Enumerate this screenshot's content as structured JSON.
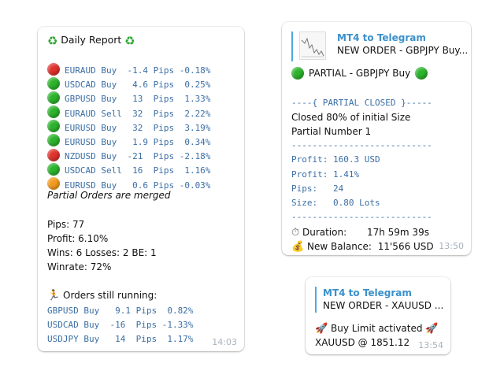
{
  "daily_report": {
    "title": "Daily Report",
    "trades": [
      {
        "status": "red",
        "text": "EURAUD Buy  -1.4 Pips -0.18%"
      },
      {
        "status": "green",
        "text": "USDCAD Buy   4.6 Pips  0.25%"
      },
      {
        "status": "green",
        "text": "GBPUSD Buy   13  Pips  1.33%"
      },
      {
        "status": "green",
        "text": "EURAUD Sell  32  Pips  2.22%"
      },
      {
        "status": "green",
        "text": "EURUSD Buy   32  Pips  3.19%"
      },
      {
        "status": "green",
        "text": "EURUSD Buy   1.9 Pips  0.34%"
      },
      {
        "status": "red",
        "text": "NZDUSD Buy  -21  Pips -2.18%"
      },
      {
        "status": "green",
        "text": "USDCAD Sell  16  Pips  1.16%"
      },
      {
        "status": "orange",
        "text": "EURUSD Buy   0.6 Pips -0.03%"
      }
    ],
    "merged_note": "Partial Orders are merged",
    "pips": "Pips: 77",
    "profit": "Profit: 6.10%",
    "wins": "Wins: 6  Losses: 2  BE: 1",
    "winrate": "Winrate: 72%",
    "running_title": "Orders still running:",
    "running": [
      "GBPUSD Buy   9.1 Pips  0.82%",
      "USDCAD Buy  -16  Pips -1.33%",
      "USDJPY Buy   14  Pips  1.17%"
    ],
    "time": "14:03"
  },
  "partial_message": {
    "reply_title": "MT4 to Telegram",
    "reply_body": "NEW ORDER - GBPJPY Buy...",
    "headline": "PARTIAL - GBPJPY Buy",
    "closed_header": "----{ PARTIAL CLOSED }-----",
    "closed_line": "Closed 80% of initial Size",
    "partial_number": "Partial Number 1",
    "separator": "---------------------------",
    "profit_usd": "Profit: 160.3 USD",
    "profit_pct": "Profit: 1.41%",
    "pips": "Pips:   24",
    "size": "Size:   0.80 Lots",
    "duration_label": "Duration:",
    "duration_value": "17h 59m 39s",
    "balance_label": "New Balance:",
    "balance_value": "11'566 USD",
    "time": "13:50"
  },
  "limit_message": {
    "reply_title": "MT4 to Telegram",
    "reply_body": "NEW ORDER - XAUUSD ...",
    "headline": "Buy Limit activated",
    "detail": "XAUUSD @ 1851.12",
    "time": "13:54"
  },
  "colors": {
    "red": "#e0322c",
    "green": "#2cb32c",
    "orange": "#f39a1e",
    "accent": "#3a90cc",
    "mono": "#3a6ea5"
  },
  "icons": {
    "report": "recycle-icon",
    "running": "runner-icon",
    "partial": "green-circle-icon",
    "duration": "stopwatch-icon",
    "balance": "money-bag-icon",
    "limit": "rocket-icon"
  }
}
